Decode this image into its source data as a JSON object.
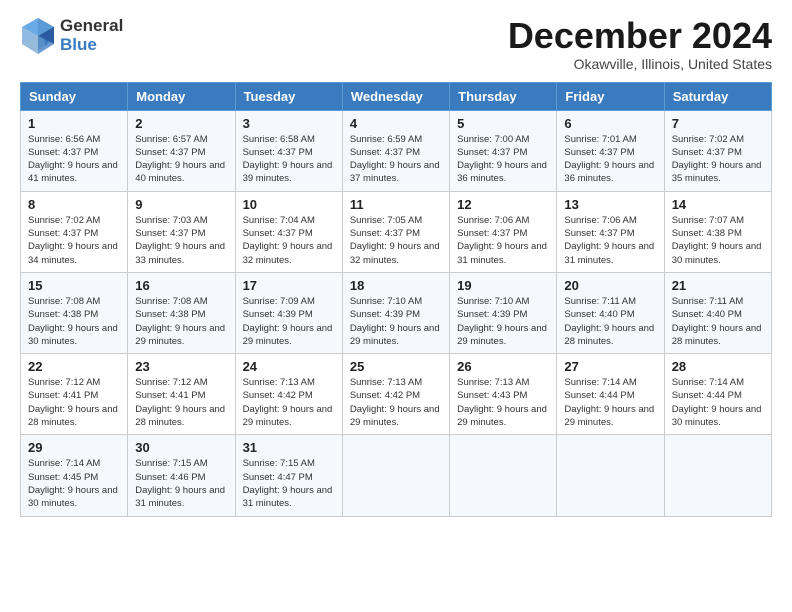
{
  "header": {
    "logo_line1": "General",
    "logo_line2": "Blue",
    "month": "December 2024",
    "location": "Okawville, Illinois, United States"
  },
  "days_of_week": [
    "Sunday",
    "Monday",
    "Tuesday",
    "Wednesday",
    "Thursday",
    "Friday",
    "Saturday"
  ],
  "weeks": [
    [
      {
        "day": "1",
        "sunrise": "6:56 AM",
        "sunset": "4:37 PM",
        "daylight": "9 hours and 41 minutes."
      },
      {
        "day": "2",
        "sunrise": "6:57 AM",
        "sunset": "4:37 PM",
        "daylight": "9 hours and 40 minutes."
      },
      {
        "day": "3",
        "sunrise": "6:58 AM",
        "sunset": "4:37 PM",
        "daylight": "9 hours and 39 minutes."
      },
      {
        "day": "4",
        "sunrise": "6:59 AM",
        "sunset": "4:37 PM",
        "daylight": "9 hours and 37 minutes."
      },
      {
        "day": "5",
        "sunrise": "7:00 AM",
        "sunset": "4:37 PM",
        "daylight": "9 hours and 36 minutes."
      },
      {
        "day": "6",
        "sunrise": "7:01 AM",
        "sunset": "4:37 PM",
        "daylight": "9 hours and 36 minutes."
      },
      {
        "day": "7",
        "sunrise": "7:02 AM",
        "sunset": "4:37 PM",
        "daylight": "9 hours and 35 minutes."
      }
    ],
    [
      {
        "day": "8",
        "sunrise": "7:02 AM",
        "sunset": "4:37 PM",
        "daylight": "9 hours and 34 minutes."
      },
      {
        "day": "9",
        "sunrise": "7:03 AM",
        "sunset": "4:37 PM",
        "daylight": "9 hours and 33 minutes."
      },
      {
        "day": "10",
        "sunrise": "7:04 AM",
        "sunset": "4:37 PM",
        "daylight": "9 hours and 32 minutes."
      },
      {
        "day": "11",
        "sunrise": "7:05 AM",
        "sunset": "4:37 PM",
        "daylight": "9 hours and 32 minutes."
      },
      {
        "day": "12",
        "sunrise": "7:06 AM",
        "sunset": "4:37 PM",
        "daylight": "9 hours and 31 minutes."
      },
      {
        "day": "13",
        "sunrise": "7:06 AM",
        "sunset": "4:37 PM",
        "daylight": "9 hours and 31 minutes."
      },
      {
        "day": "14",
        "sunrise": "7:07 AM",
        "sunset": "4:38 PM",
        "daylight": "9 hours and 30 minutes."
      }
    ],
    [
      {
        "day": "15",
        "sunrise": "7:08 AM",
        "sunset": "4:38 PM",
        "daylight": "9 hours and 30 minutes."
      },
      {
        "day": "16",
        "sunrise": "7:08 AM",
        "sunset": "4:38 PM",
        "daylight": "9 hours and 29 minutes."
      },
      {
        "day": "17",
        "sunrise": "7:09 AM",
        "sunset": "4:39 PM",
        "daylight": "9 hours and 29 minutes."
      },
      {
        "day": "18",
        "sunrise": "7:10 AM",
        "sunset": "4:39 PM",
        "daylight": "9 hours and 29 minutes."
      },
      {
        "day": "19",
        "sunrise": "7:10 AM",
        "sunset": "4:39 PM",
        "daylight": "9 hours and 29 minutes."
      },
      {
        "day": "20",
        "sunrise": "7:11 AM",
        "sunset": "4:40 PM",
        "daylight": "9 hours and 28 minutes."
      },
      {
        "day": "21",
        "sunrise": "7:11 AM",
        "sunset": "4:40 PM",
        "daylight": "9 hours and 28 minutes."
      }
    ],
    [
      {
        "day": "22",
        "sunrise": "7:12 AM",
        "sunset": "4:41 PM",
        "daylight": "9 hours and 28 minutes."
      },
      {
        "day": "23",
        "sunrise": "7:12 AM",
        "sunset": "4:41 PM",
        "daylight": "9 hours and 28 minutes."
      },
      {
        "day": "24",
        "sunrise": "7:13 AM",
        "sunset": "4:42 PM",
        "daylight": "9 hours and 29 minutes."
      },
      {
        "day": "25",
        "sunrise": "7:13 AM",
        "sunset": "4:42 PM",
        "daylight": "9 hours and 29 minutes."
      },
      {
        "day": "26",
        "sunrise": "7:13 AM",
        "sunset": "4:43 PM",
        "daylight": "9 hours and 29 minutes."
      },
      {
        "day": "27",
        "sunrise": "7:14 AM",
        "sunset": "4:44 PM",
        "daylight": "9 hours and 29 minutes."
      },
      {
        "day": "28",
        "sunrise": "7:14 AM",
        "sunset": "4:44 PM",
        "daylight": "9 hours and 30 minutes."
      }
    ],
    [
      {
        "day": "29",
        "sunrise": "7:14 AM",
        "sunset": "4:45 PM",
        "daylight": "9 hours and 30 minutes."
      },
      {
        "day": "30",
        "sunrise": "7:15 AM",
        "sunset": "4:46 PM",
        "daylight": "9 hours and 31 minutes."
      },
      {
        "day": "31",
        "sunrise": "7:15 AM",
        "sunset": "4:47 PM",
        "daylight": "9 hours and 31 minutes."
      },
      null,
      null,
      null,
      null
    ]
  ]
}
